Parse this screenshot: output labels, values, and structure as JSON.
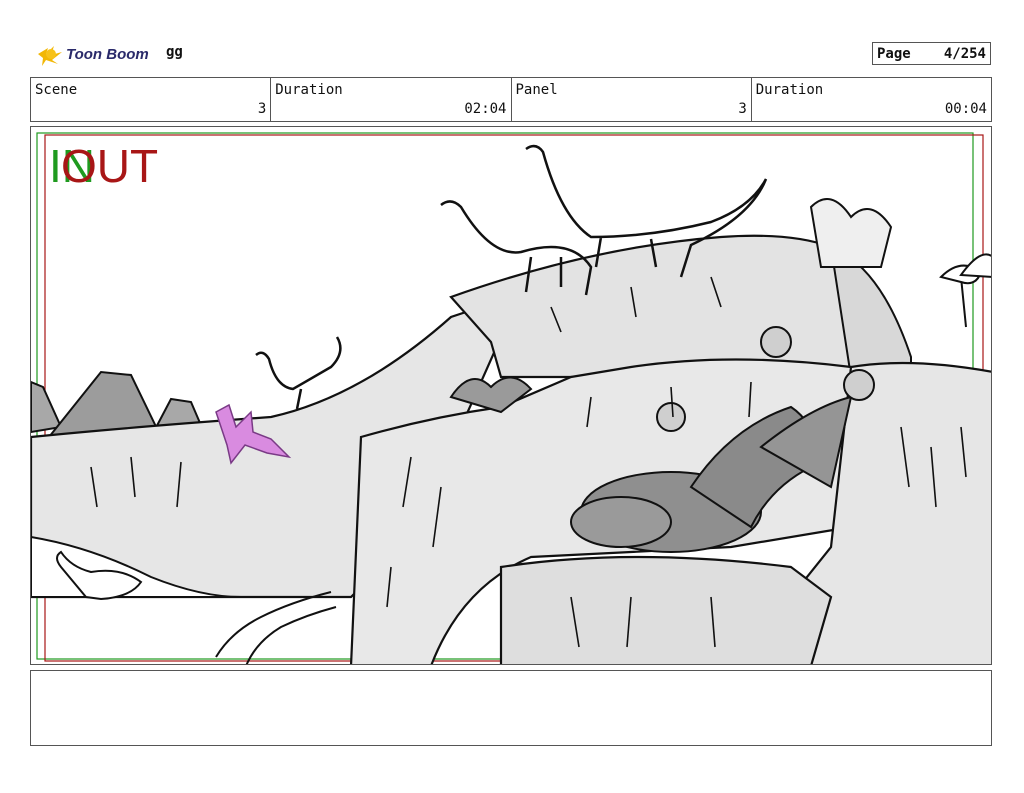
{
  "header": {
    "logo_text": "Toon Boom",
    "project_name": "gg",
    "page_label": "Page",
    "page_value": "4/254"
  },
  "info": {
    "scene_label": "Scene",
    "scene_value": "3",
    "scene_duration_label": "Duration",
    "scene_duration_value": "02:04",
    "panel_label": "Panel",
    "panel_value": "3",
    "panel_duration_label": "Duration",
    "panel_duration_value": "00:04"
  },
  "panel": {
    "in_label": "IN",
    "out_label": "OUT",
    "image_description_icon": "storyboard-drawing-icon"
  },
  "colors": {
    "in_marker": "#1f9a1f",
    "out_marker": "#a81616",
    "logo_accent": "#f2b705",
    "highlight_creature": "#d98be0"
  }
}
